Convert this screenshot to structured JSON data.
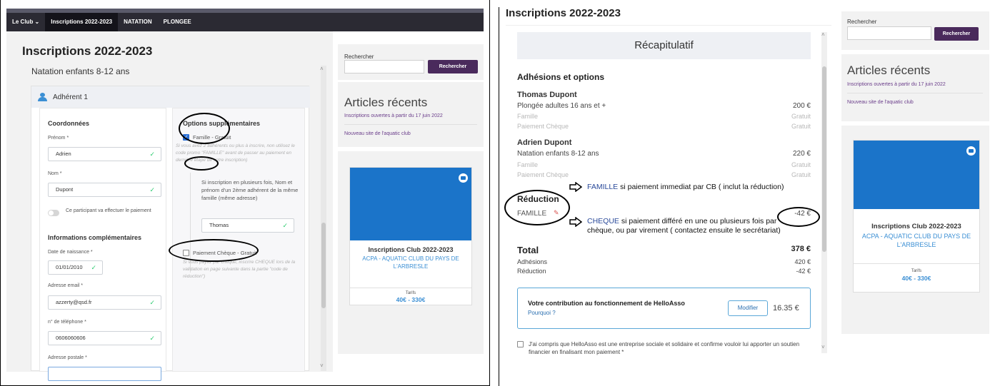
{
  "left": {
    "nav": [
      {
        "label": "Le Club ⌄"
      },
      {
        "label": "Inscriptions 2022-2023"
      },
      {
        "label": "NATATION"
      },
      {
        "label": "PLONGEE"
      }
    ],
    "page_title": "Inscriptions 2022-2023",
    "activity": "Natation enfants 8-12 ans",
    "adherent_header": "Adhérent 1",
    "coordonnees": {
      "title": "Coordonnées",
      "prenom_label": "Prénom *",
      "prenom_value": "Adrien",
      "nom_label": "Nom *",
      "nom_value": "Dupont",
      "payer_toggle_label": "Ce participant va effectuer le paiement",
      "info_title": "Informations complémentaires",
      "dob_label": "Date de naissance *",
      "dob_value": "01/01/2010",
      "email_label": "Adresse email *",
      "email_value": "azzerty@qsd.fr",
      "phone_label": "n° de téléphone *",
      "phone_value": "0606060606",
      "address_label": "Adresse postale *"
    },
    "options": {
      "title": "Options supplémentaires",
      "famille_label": "Famille - Gratuit",
      "famille_checked": true,
      "famille_help": "Si vous avez 2 adhérents ou plus à inscrire, non utilisez le code promo \"FAMILLE\" avant de passer au paiement en dernière étape de votre inscription)",
      "famille_sub_text": "Si inscription en plusieurs fois, Nom et prénom d'un 2ème adhérent de la même famille (même adresse)",
      "famille_sub_value": "Thomas",
      "cheque_label": "Paiement Chèque - Gratuit",
      "cheque_checked": false,
      "cheque_help": "Si vous payez par chèque, inscrire CHEQUE lors de la validation en page suivante dans la partie \"code de réduction\")"
    },
    "sidebar": {
      "search_label": "Rechercher",
      "search_button": "Rechercher",
      "recent_title": "Articles récents",
      "recent_links": [
        "Inscriptions ouvertes à partir du 17 juin 2022",
        "Nouveau site de l'aquatic club"
      ],
      "product": {
        "name": "Inscriptions Club 2022-2023",
        "club": "ACPA - AQUATIC CLUB DU PAYS DE L'ARBRESLE",
        "tarif_label": "Tarifs",
        "price": "40€ - 330€"
      }
    }
  },
  "right": {
    "page_title": "Inscriptions 2022-2023",
    "recap_title": "Récapitulatif",
    "section_title": "Adhésions et options",
    "members": [
      {
        "name": "Thomas Dupont",
        "activity": "Plongée adultes 16 ans et +",
        "activity_amount": "200 €",
        "options": [
          {
            "label": "Famille",
            "amount": "Gratuit"
          },
          {
            "label": "Paiement Chèque",
            "amount": "Gratuit"
          }
        ]
      },
      {
        "name": "Adrien Dupont",
        "activity": "Natation enfants 8-12 ans",
        "activity_amount": "220 €",
        "options": [
          {
            "label": "Famille",
            "amount": "Gratuit"
          },
          {
            "label": "Paiement Chèque",
            "amount": "Gratuit"
          }
        ]
      }
    ],
    "reduction_title": "Réduction",
    "reduction_code": "FAMILLE",
    "reduction_amount": "-42 €",
    "annotation_famille_kw": "FAMILLE",
    "annotation_famille_text": "si paiement immediat par CB  ( inclut la réduction)",
    "annotation_cheque_kw": "CHEQUE",
    "annotation_cheque_text": "si paiement différé en une ou plusieurs fois par chèque, ou par virement  ( contactez ensuite le secrétariat)",
    "total_label": "Total",
    "total_value": "378 €",
    "adhesions_label": "Adhésions",
    "adhesions_value": "420 €",
    "reduction_label": "Réduction",
    "reduction_value": "-42 €",
    "contribution_title": "Votre contribution au fonctionnement de HelloAsso",
    "contribution_why": "Pourquoi ?",
    "contribution_button": "Modifier",
    "contribution_amount": "16.35 €",
    "consent_text": "J'ai compris que HelloAsso est une entreprise sociale et solidaire et confirme vouloir lui apporter un soutien financier en finalisant mon paiement *",
    "sidebar": {
      "search_label": "Rechercher",
      "search_button": "Rechercher",
      "recent_title": "Articles récents",
      "recent_links": [
        "Inscriptions ouvertes à partir du 17 juin 2022",
        "Nouveau site de l'aquatic club"
      ],
      "product": {
        "name": "Inscriptions Club 2022-2023",
        "club": "ACPA - AQUATIC CLUB DU PAYS DE L'ARBRESLE",
        "tarif_label": "Tarifs",
        "price": "40€ - 330€"
      }
    }
  },
  "colors": {
    "nav_bg": "#2b2a33",
    "accent_purple": "#4a2a5c",
    "product_blue": "#1b74c9",
    "link_blue": "#3b8fd4",
    "valid_green": "#2ecc71"
  }
}
